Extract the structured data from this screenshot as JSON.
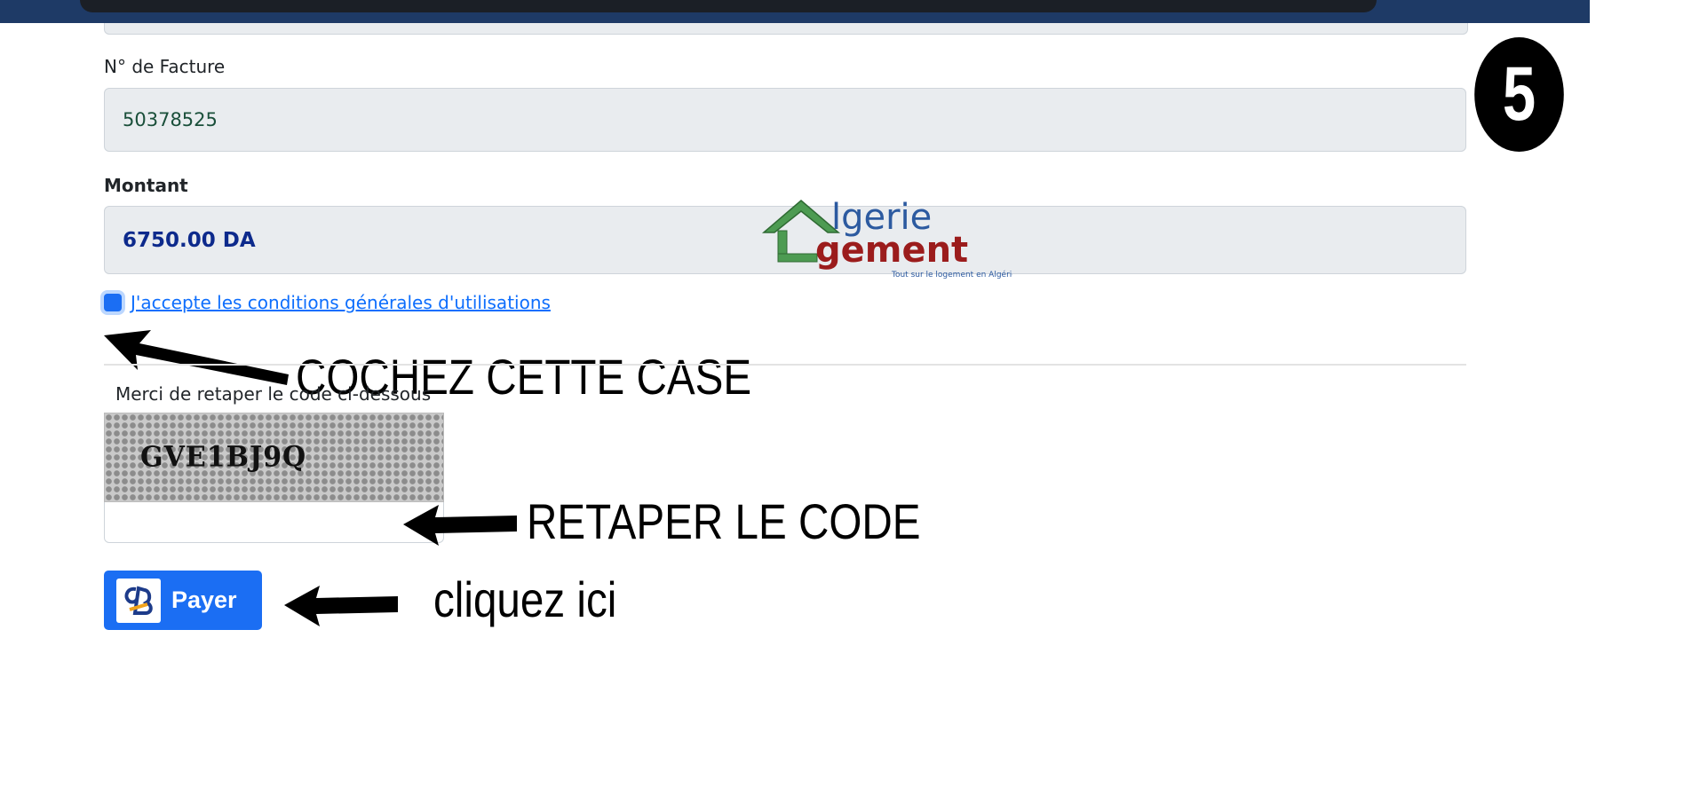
{
  "form": {
    "invoice_label": "N° de Facture",
    "invoice_value": "50378525",
    "amount_label": "Montant",
    "amount_value": "6750.00 DA",
    "terms_checkbox_label": "J'accepte les conditions générales d'utilisations",
    "terms_checked": true,
    "captcha_label": "Merci de retaper le code ci-dessous",
    "captcha_code": "GVE1BJ9Q",
    "captcha_input_value": "",
    "pay_button_label": "Payer"
  },
  "overlay": {
    "step_number": "5",
    "arrow_checkbox_text": "COCHEZ CETTE CASE",
    "arrow_captcha_text": "RETAPER LE CODE",
    "arrow_pay_text": "cliquez ici"
  },
  "watermark": {
    "line1": "lgerie",
    "line2": "gement",
    "tagline": "Tout sur le logement en Algérie"
  },
  "colors": {
    "top_bar": "#1e3a66",
    "accent_button": "#1b6ef3",
    "link": "#0d6efd",
    "amount_text": "#0d2a8c"
  }
}
